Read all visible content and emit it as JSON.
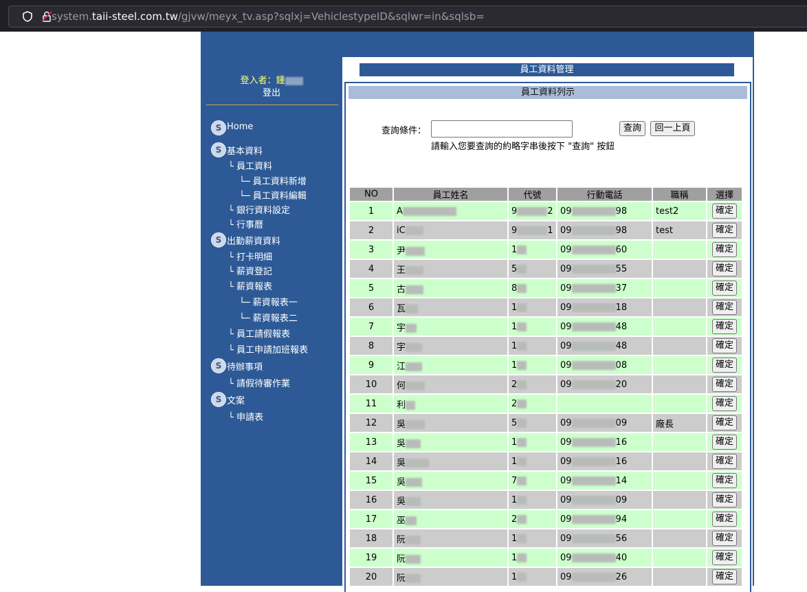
{
  "browser": {
    "url_prefix": "system.",
    "url_domain": "taii-steel.com.tw",
    "url_path": "/gjvw/meyx_tv.asp?sqlxj=VehiclestypeID&sqlwr=in&sqlsb="
  },
  "nav": {
    "user_label": "登入者：鍾",
    "logout": "登出",
    "items": [
      {
        "label": "Home",
        "icon": "s-logo-icon"
      },
      {
        "label": "基本資料",
        "icon": "s-logo-icon"
      },
      {
        "label": "└ 員工資料"
      },
      {
        "label": "└─ 員工資料新增"
      },
      {
        "label": "└─ 員工資料編輯"
      },
      {
        "label": "└ 銀行資料設定"
      },
      {
        "label": "└ 行事曆"
      },
      {
        "label": "出勤薪資資料",
        "icon": "s-logo-icon"
      },
      {
        "label": "└ 打卡明細"
      },
      {
        "label": "└ 薪資登記"
      },
      {
        "label": "└ 薪資報表"
      },
      {
        "label": "└─ 薪資報表一"
      },
      {
        "label": "└─ 薪資報表二"
      },
      {
        "label": "└ 員工請假報表"
      },
      {
        "label": "└ 員工申請加班報表"
      },
      {
        "label": "待辦事項",
        "icon": "s-logo-icon"
      },
      {
        "label": "└ 請假待審作業"
      },
      {
        "label": "文案",
        "icon": "s-logo-icon"
      },
      {
        "label": "└ 申請表"
      }
    ]
  },
  "main": {
    "title": "員工資料管理",
    "list_title": "員工資料列示",
    "query_label": "查詢條件：",
    "query_value": "",
    "search_button": "查詢",
    "back_button": "回一上頁",
    "hint": "請輸入您要查詢的約略字串後按下 \"查詢\" 按鈕"
  },
  "table": {
    "headers": [
      "NO",
      "員工姓名",
      "代號",
      "行動電話",
      "職稱",
      "選擇"
    ],
    "confirm_label": "確定",
    "rows": [
      {
        "no": "1",
        "name": "A",
        "code": "9",
        "code_end": "2",
        "phone": "09",
        "phone_end": "98",
        "title": "test2"
      },
      {
        "no": "2",
        "name": "iC",
        "code": "9",
        "code_end": "1",
        "phone": "09",
        "phone_end": "98",
        "title": "test"
      },
      {
        "no": "3",
        "name": "尹",
        "code": "1",
        "code_end": "",
        "phone": "09",
        "phone_end": "60",
        "title": ""
      },
      {
        "no": "4",
        "name": "王",
        "code": "5",
        "code_end": "",
        "phone": "09",
        "phone_end": "55",
        "title": ""
      },
      {
        "no": "5",
        "name": "古",
        "code": "8",
        "code_end": "",
        "phone": "09",
        "phone_end": "37",
        "title": ""
      },
      {
        "no": "6",
        "name": "瓦",
        "code": "1",
        "code_end": "",
        "phone": "09",
        "phone_end": "18",
        "title": ""
      },
      {
        "no": "7",
        "name": "宇",
        "code": "1",
        "code_end": "",
        "phone": "09",
        "phone_end": "48",
        "title": ""
      },
      {
        "no": "8",
        "name": "宇",
        "code": "1",
        "code_end": "",
        "phone": "09",
        "phone_end": "48",
        "title": ""
      },
      {
        "no": "9",
        "name": "江",
        "code": "1",
        "code_end": "",
        "phone": "09",
        "phone_end": "08",
        "title": ""
      },
      {
        "no": "10",
        "name": "何",
        "code": "2",
        "code_end": "",
        "phone": "09",
        "phone_end": "20",
        "title": ""
      },
      {
        "no": "11",
        "name": "利",
        "code": "2",
        "code_end": "",
        "phone": "",
        "phone_end": "",
        "title": ""
      },
      {
        "no": "12",
        "name": "吳",
        "code": "5",
        "code_end": "",
        "phone": "09",
        "phone_end": "09",
        "title": "廠長"
      },
      {
        "no": "13",
        "name": "吳",
        "code": "1",
        "code_end": "",
        "phone": "09",
        "phone_end": "16",
        "title": ""
      },
      {
        "no": "14",
        "name": "吳",
        "code": "1",
        "code_end": "",
        "phone": "09",
        "phone_end": "16",
        "title": ""
      },
      {
        "no": "15",
        "name": "吳",
        "code": "7",
        "code_end": "",
        "phone": "09",
        "phone_end": "14",
        "title": ""
      },
      {
        "no": "16",
        "name": "吳",
        "code": "1",
        "code_end": "",
        "phone": "09",
        "phone_end": "09",
        "title": ""
      },
      {
        "no": "17",
        "name": "巫",
        "code": "2",
        "code_end": "",
        "phone": "09",
        "phone_end": "94",
        "title": ""
      },
      {
        "no": "18",
        "name": "阮",
        "code": "1",
        "code_end": "",
        "phone": "09",
        "phone_end": "56",
        "title": ""
      },
      {
        "no": "19",
        "name": "阮",
        "code": "1",
        "code_end": "",
        "phone": "09",
        "phone_end": "40",
        "title": ""
      },
      {
        "no": "20",
        "name": "阮",
        "code": "1",
        "code_end": "",
        "phone": "09",
        "phone_end": "26",
        "title": ""
      }
    ]
  }
}
